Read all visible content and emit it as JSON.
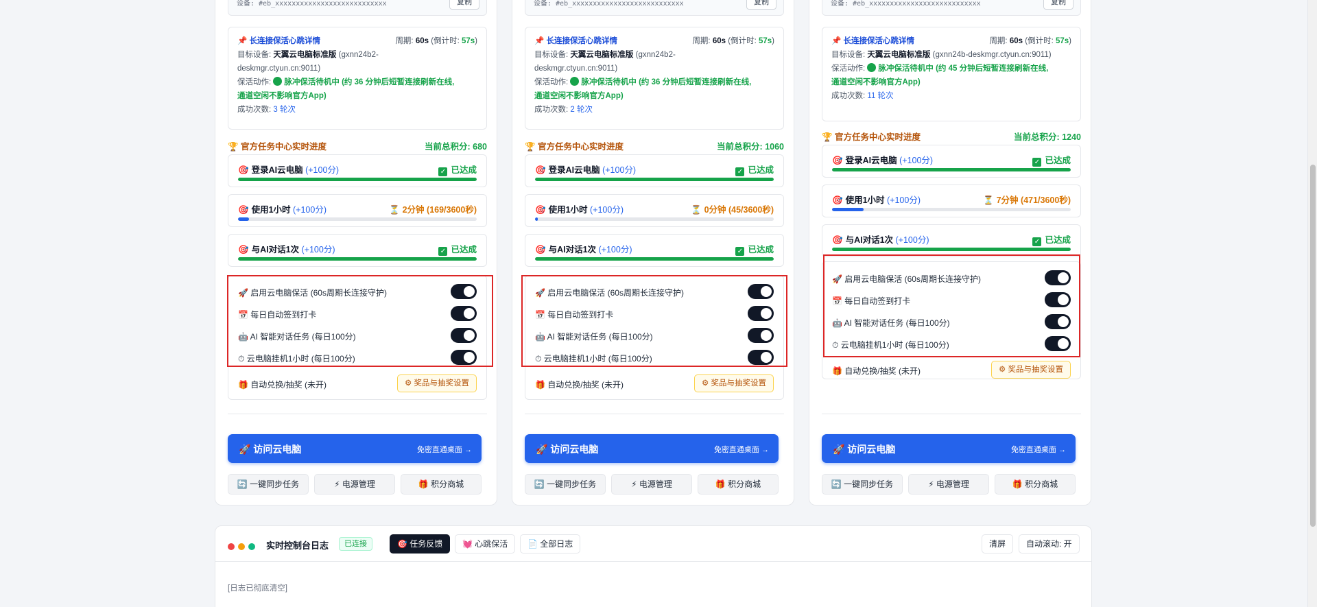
{
  "cards": [
    {
      "device_code": "设备: #eb_xxxxxxxxxxxxxxxxxxxxxxxxxxx",
      "copy_label": "复制",
      "heartbeat": {
        "title": "长连接保活心跳详情",
        "period_label": "周期:",
        "period": "60s",
        "countdown_label": "(倒计时:",
        "countdown": "57s",
        "countdown_close": ")",
        "target_label": "目标设备:",
        "target_name": "天翼云电脑标准版",
        "target_host_l1": "(gxnn24b2-",
        "target_host_l2": "deskmgr.ctyun.cn:9011)",
        "action_label": "保活动作:",
        "action_l1": "脉冲保活待机中 (约 36 分钟后短暂连接刷新在线,",
        "action_l2": "通道空闲不影响官方App)",
        "success_label": "成功次数:",
        "success": "3 轮次"
      },
      "tasks_title": "官方任务中心实时进度",
      "score_label": "当前总积分:",
      "score": "680",
      "tasks": [
        {
          "name": "登录AI云电脑",
          "points": "(+100分)",
          "status": "已达成",
          "state": "done",
          "progress": 1.0
        },
        {
          "name": "使用1小时",
          "points": "(+100分)",
          "status": "2分钟 (169/3600秒)",
          "state": "progress",
          "progress": 0.047
        },
        {
          "name": "与AI对话1次",
          "points": "(+100分)",
          "status": "已达成",
          "state": "done",
          "progress": 1.0
        }
      ],
      "switches": [
        {
          "label": "启用云电脑保活 (60s周期长连接守护)",
          "on": true
        },
        {
          "label": "每日自动签到打卡",
          "on": true
        },
        {
          "label": "AI 智能对话任务 (每日100分)",
          "on": true
        },
        {
          "label": "云电脑挂机1小时 (每日100分)",
          "on": true
        }
      ],
      "redeem_label": "自动兑换/抽奖 (未开)",
      "prize_label": "奖品与抽奖设置",
      "visit_label": "访问云电脑",
      "visit_sub": "免密直通桌面 →",
      "actions": [
        "一键同步任务",
        "电源管理",
        "积分商城"
      ]
    },
    {
      "device_code": "设备: #eb_xxxxxxxxxxxxxxxxxxxxxxxxxxx",
      "copy_label": "复制",
      "heartbeat": {
        "title": "长连接保活心跳详情",
        "period_label": "周期:",
        "period": "60s",
        "countdown_label": "(倒计时:",
        "countdown": "57s",
        "countdown_close": ")",
        "target_label": "目标设备:",
        "target_name": "天翼云电脑标准版",
        "target_host_l1": "(gxnn24b2-",
        "target_host_l2": "deskmgr.ctyun.cn:9011)",
        "action_label": "保活动作:",
        "action_l1": "脉冲保活待机中 (约 36 分钟后短暂连接刷新在线,",
        "action_l2": "通道空闲不影响官方App)",
        "success_label": "成功次数:",
        "success": "2 轮次"
      },
      "tasks_title": "官方任务中心实时进度",
      "score_label": "当前总积分:",
      "score": "1060",
      "tasks": [
        {
          "name": "登录AI云电脑",
          "points": "(+100分)",
          "status": "已达成",
          "state": "done",
          "progress": 1.0
        },
        {
          "name": "使用1小时",
          "points": "(+100分)",
          "status": "0分钟 (45/3600秒)",
          "state": "progress",
          "progress": 0.0125
        },
        {
          "name": "与AI对话1次",
          "points": "(+100分)",
          "status": "已达成",
          "state": "done",
          "progress": 1.0
        }
      ],
      "switches": [
        {
          "label": "启用云电脑保活 (60s周期长连接守护)",
          "on": true
        },
        {
          "label": "每日自动签到打卡",
          "on": true
        },
        {
          "label": "AI 智能对话任务 (每日100分)",
          "on": true
        },
        {
          "label": "云电脑挂机1小时 (每日100分)",
          "on": true
        }
      ],
      "redeem_label": "自动兑换/抽奖 (未开)",
      "prize_label": "奖品与抽奖设置",
      "visit_label": "访问云电脑",
      "visit_sub": "免密直通桌面 →",
      "actions": [
        "一键同步任务",
        "电源管理",
        "积分商城"
      ]
    },
    {
      "device_code": "设备: #eb_xxxxxxxxxxxxxxxxxxxxxxxxxxx",
      "copy_label": "复制",
      "heartbeat": {
        "title": "长连接保活心跳详情",
        "period_label": "周期:",
        "period": "60s",
        "countdown_label": "(倒计时:",
        "countdown": "57s",
        "countdown_close": ")",
        "target_label": "目标设备:",
        "target_name": "天翼云电脑标准版",
        "target_host_l1": "(gxnn24b-deskmgr.ctyun.cn:9011)",
        "target_host_l2": "",
        "action_label": "保活动作:",
        "action_l1": "脉冲保活待机中 (约 45 分钟后短暂连接刷新在线,",
        "action_l2": "通道空闲不影响官方App)",
        "success_label": "成功次数:",
        "success": "11 轮次"
      },
      "tasks_title": "官方任务中心实时进度",
      "score_label": "当前总积分:",
      "score": "1240",
      "tasks": [
        {
          "name": "登录AI云电脑",
          "points": "(+100分)",
          "status": "已达成",
          "state": "done",
          "progress": 1.0
        },
        {
          "name": "使用1小时",
          "points": "(+100分)",
          "status": "7分钟 (471/3600秒)",
          "state": "progress",
          "progress": 0.131
        },
        {
          "name": "与AI对话1次",
          "points": "(+100分)",
          "status": "已达成",
          "state": "done",
          "progress": 1.0
        }
      ],
      "switches": [
        {
          "label": "启用云电脑保活 (60s周期长连接守护)",
          "on": true
        },
        {
          "label": "每日自动签到打卡",
          "on": true
        },
        {
          "label": "AI 智能对话任务 (每日100分)",
          "on": true
        },
        {
          "label": "云电脑挂机1小时 (每日100分)",
          "on": true
        }
      ],
      "redeem_label": "自动兑换/抽奖 (未开)",
      "prize_label": "奖品与抽奖设置",
      "visit_label": "访问云电脑",
      "visit_sub": "免密直通桌面 →",
      "actions": [
        "一键同步任务",
        "电源管理",
        "积分商城"
      ]
    }
  ],
  "log": {
    "title": "实时控制台日志",
    "status": "已连接",
    "tabs": [
      "任务反馈",
      "心跳保活",
      "全部日志"
    ],
    "clear_label": "清屏",
    "autoscroll_label": "自动滚动: 开",
    "cleared_text": "[日志已彻底清空]"
  },
  "colors": {
    "accent": "#2563eb",
    "success": "#16a34a",
    "warning": "#d97706",
    "highlight": "#dc2626",
    "toggle_on": "#111827"
  }
}
